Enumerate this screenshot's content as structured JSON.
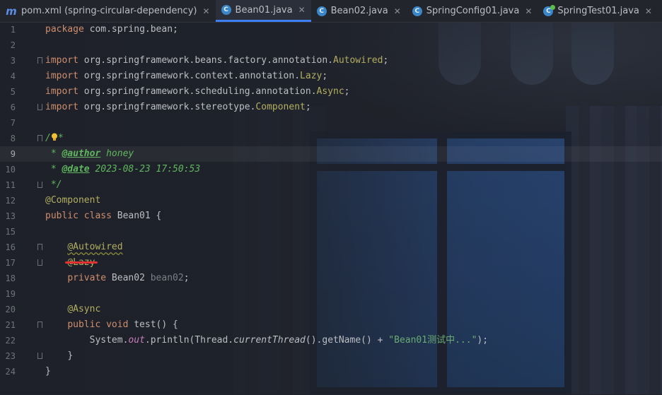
{
  "tabs": [
    {
      "label": "pom.xml (spring-circular-dependency)",
      "icon": "maven-icon",
      "active": false
    },
    {
      "label": "Bean01.java",
      "icon": "class-icon",
      "active": true
    },
    {
      "label": "Bean02.java",
      "icon": "class-icon",
      "active": false
    },
    {
      "label": "SpringConfig01.java",
      "icon": "class-icon",
      "active": false
    },
    {
      "label": "SpringTest01.java",
      "icon": "test-class-icon",
      "active": false
    }
  ],
  "tab_close_glyph": "✕",
  "editor": {
    "current_line": "9",
    "line_numbers": [
      "1",
      "2",
      "3",
      "4",
      "5",
      "6",
      "7",
      "8",
      "9",
      "10",
      "11",
      "12",
      "13",
      "15",
      "16",
      "17",
      "18",
      "19",
      "20",
      "21",
      "22",
      "23",
      "24"
    ],
    "l1": {
      "kw": "package",
      "rest": " com.spring.bean;"
    },
    "imports": [
      {
        "kw": "import",
        "pkg": " org.springframework.beans.factory.annotation.",
        "cls": "Autowired",
        "end": ";"
      },
      {
        "kw": "import",
        "pkg": " org.springframework.context.annotation.",
        "cls": "Lazy",
        "end": ";"
      },
      {
        "kw": "import",
        "pkg": " org.springframework.scheduling.annotation.",
        "cls": "Async",
        "end": ";"
      },
      {
        "kw": "import",
        "pkg": " org.springframework.stereotype.",
        "cls": "Component",
        "end": ";"
      }
    ],
    "doc_open": "/",
    "doc_star": "*",
    "doc_author_prefix": " * ",
    "doc_author_tag": "@author",
    "doc_author_val": " honey",
    "doc_date_prefix": " * ",
    "doc_date_tag": "@date",
    "doc_date_val": " 2023-08-23 17:50:53",
    "doc_close": " */",
    "ann_component": "@Component",
    "class_kw": "public class",
    "class_rest": " Bean01 {",
    "ann_autowired": "@Autowired",
    "ann_lazy": "@Lazy",
    "field_kw": "private",
    "field_type": " Bean02 ",
    "field_name": "bean02",
    "field_end": ";",
    "ann_async": "@Async",
    "method_kw": "public void",
    "method_name": " test",
    "method_rest": "() {",
    "stmt_a": "System.",
    "stmt_out": "out",
    "stmt_b": ".println(Thread.",
    "stmt_cur": "currentThread",
    "stmt_c": "().getName() + ",
    "stmt_str": "\"Bean01测试中...\"",
    "stmt_d": ");",
    "close_method": "}",
    "close_class": "}"
  },
  "colors": {
    "accent": "#3d7ef0",
    "keyword": "#cf8e6d",
    "annotation": "#b3ae60",
    "comment": "#5fb65e",
    "string": "#6aab73",
    "field": "#c77dbb",
    "error_underline": "#e03030"
  }
}
